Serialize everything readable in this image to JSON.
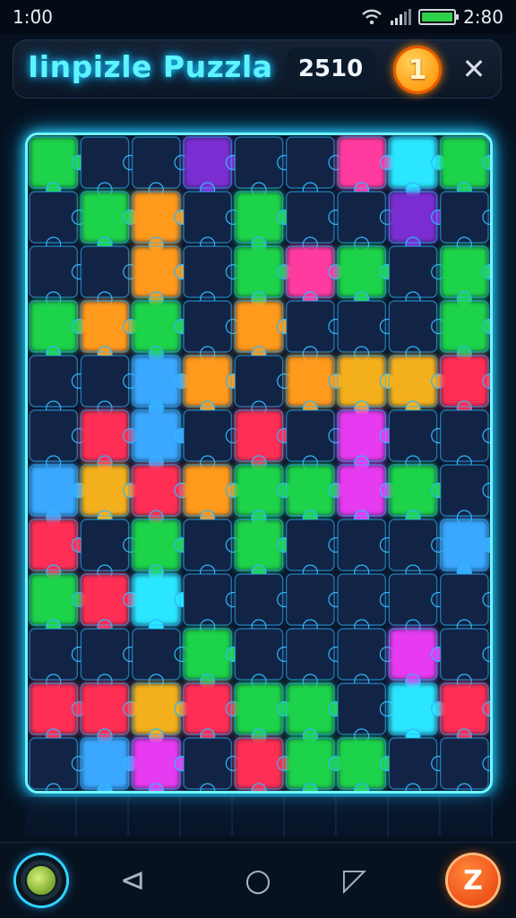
{
  "status": {
    "time": "1:0̈0",
    "clock_right": "2:80"
  },
  "header": {
    "title": "Iinpizle Puzzla",
    "score": "2510",
    "coin_label": "1",
    "close_label": "✕"
  },
  "nav": {
    "back_icon": "⊲",
    "home_icon": "○",
    "square_icon": "◸",
    "hint_label": "Z"
  },
  "colors": {
    "board_bg": "#0a1830",
    "grid_line": "#2fb8ff",
    "pieces": {
      "G": "#1fd34a",
      "O": "#ff9a1c",
      "Y": "#f4b01a",
      "R": "#ff2d55",
      "P": "#e63af0",
      "B": "#3aa8ff",
      "C": "#29e6ff",
      "V": "#7a2fd1",
      "M": "#ff3aa0",
      "D": "#122445"
    }
  },
  "board": {
    "cols": 9,
    "rows": 12,
    "cells": [
      "GDDVDDMCG",
      "DGODGDDVD",
      "DDODGMGDG",
      "GOGDODDDG",
      "DDBODOYYR",
      "DRBDRDPDD",
      "BYROGGPGD",
      "RDGDGDDDB",
      "GRCDDDDDD",
      "DDDGDDDPD",
      "RRYRGGDCR",
      "DBPDRGGDD"
    ]
  }
}
